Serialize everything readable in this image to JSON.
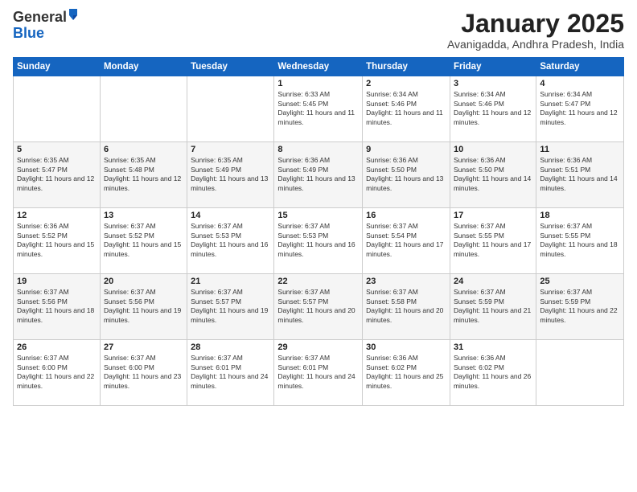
{
  "logo": {
    "general": "General",
    "blue": "Blue"
  },
  "header": {
    "month": "January 2025",
    "location": "Avanigadda, Andhra Pradesh, India"
  },
  "weekdays": [
    "Sunday",
    "Monday",
    "Tuesday",
    "Wednesday",
    "Thursday",
    "Friday",
    "Saturday"
  ],
  "weeks": [
    [
      {
        "day": "",
        "info": ""
      },
      {
        "day": "",
        "info": ""
      },
      {
        "day": "",
        "info": ""
      },
      {
        "day": "1",
        "info": "Sunrise: 6:33 AM\nSunset: 5:45 PM\nDaylight: 11 hours and 11 minutes."
      },
      {
        "day": "2",
        "info": "Sunrise: 6:34 AM\nSunset: 5:46 PM\nDaylight: 11 hours and 11 minutes."
      },
      {
        "day": "3",
        "info": "Sunrise: 6:34 AM\nSunset: 5:46 PM\nDaylight: 11 hours and 12 minutes."
      },
      {
        "day": "4",
        "info": "Sunrise: 6:34 AM\nSunset: 5:47 PM\nDaylight: 11 hours and 12 minutes."
      }
    ],
    [
      {
        "day": "5",
        "info": "Sunrise: 6:35 AM\nSunset: 5:47 PM\nDaylight: 11 hours and 12 minutes."
      },
      {
        "day": "6",
        "info": "Sunrise: 6:35 AM\nSunset: 5:48 PM\nDaylight: 11 hours and 12 minutes."
      },
      {
        "day": "7",
        "info": "Sunrise: 6:35 AM\nSunset: 5:49 PM\nDaylight: 11 hours and 13 minutes."
      },
      {
        "day": "8",
        "info": "Sunrise: 6:36 AM\nSunset: 5:49 PM\nDaylight: 11 hours and 13 minutes."
      },
      {
        "day": "9",
        "info": "Sunrise: 6:36 AM\nSunset: 5:50 PM\nDaylight: 11 hours and 13 minutes."
      },
      {
        "day": "10",
        "info": "Sunrise: 6:36 AM\nSunset: 5:50 PM\nDaylight: 11 hours and 14 minutes."
      },
      {
        "day": "11",
        "info": "Sunrise: 6:36 AM\nSunset: 5:51 PM\nDaylight: 11 hours and 14 minutes."
      }
    ],
    [
      {
        "day": "12",
        "info": "Sunrise: 6:36 AM\nSunset: 5:52 PM\nDaylight: 11 hours and 15 minutes."
      },
      {
        "day": "13",
        "info": "Sunrise: 6:37 AM\nSunset: 5:52 PM\nDaylight: 11 hours and 15 minutes."
      },
      {
        "day": "14",
        "info": "Sunrise: 6:37 AM\nSunset: 5:53 PM\nDaylight: 11 hours and 16 minutes."
      },
      {
        "day": "15",
        "info": "Sunrise: 6:37 AM\nSunset: 5:53 PM\nDaylight: 11 hours and 16 minutes."
      },
      {
        "day": "16",
        "info": "Sunrise: 6:37 AM\nSunset: 5:54 PM\nDaylight: 11 hours and 17 minutes."
      },
      {
        "day": "17",
        "info": "Sunrise: 6:37 AM\nSunset: 5:55 PM\nDaylight: 11 hours and 17 minutes."
      },
      {
        "day": "18",
        "info": "Sunrise: 6:37 AM\nSunset: 5:55 PM\nDaylight: 11 hours and 18 minutes."
      }
    ],
    [
      {
        "day": "19",
        "info": "Sunrise: 6:37 AM\nSunset: 5:56 PM\nDaylight: 11 hours and 18 minutes."
      },
      {
        "day": "20",
        "info": "Sunrise: 6:37 AM\nSunset: 5:56 PM\nDaylight: 11 hours and 19 minutes."
      },
      {
        "day": "21",
        "info": "Sunrise: 6:37 AM\nSunset: 5:57 PM\nDaylight: 11 hours and 19 minutes."
      },
      {
        "day": "22",
        "info": "Sunrise: 6:37 AM\nSunset: 5:57 PM\nDaylight: 11 hours and 20 minutes."
      },
      {
        "day": "23",
        "info": "Sunrise: 6:37 AM\nSunset: 5:58 PM\nDaylight: 11 hours and 20 minutes."
      },
      {
        "day": "24",
        "info": "Sunrise: 6:37 AM\nSunset: 5:59 PM\nDaylight: 11 hours and 21 minutes."
      },
      {
        "day": "25",
        "info": "Sunrise: 6:37 AM\nSunset: 5:59 PM\nDaylight: 11 hours and 22 minutes."
      }
    ],
    [
      {
        "day": "26",
        "info": "Sunrise: 6:37 AM\nSunset: 6:00 PM\nDaylight: 11 hours and 22 minutes."
      },
      {
        "day": "27",
        "info": "Sunrise: 6:37 AM\nSunset: 6:00 PM\nDaylight: 11 hours and 23 minutes."
      },
      {
        "day": "28",
        "info": "Sunrise: 6:37 AM\nSunset: 6:01 PM\nDaylight: 11 hours and 24 minutes."
      },
      {
        "day": "29",
        "info": "Sunrise: 6:37 AM\nSunset: 6:01 PM\nDaylight: 11 hours and 24 minutes."
      },
      {
        "day": "30",
        "info": "Sunrise: 6:36 AM\nSunset: 6:02 PM\nDaylight: 11 hours and 25 minutes."
      },
      {
        "day": "31",
        "info": "Sunrise: 6:36 AM\nSunset: 6:02 PM\nDaylight: 11 hours and 26 minutes."
      },
      {
        "day": "",
        "info": ""
      }
    ]
  ]
}
